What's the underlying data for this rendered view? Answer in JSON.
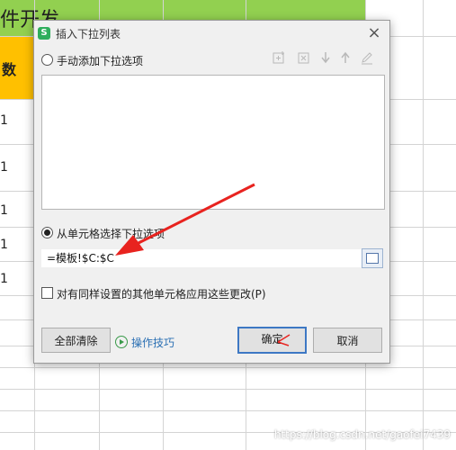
{
  "sheet": {
    "title_partial": "件开发",
    "column_header_partial": "数",
    "row_values": [
      "1",
      "1",
      "1",
      "1",
      "1"
    ],
    "watermark": "https://blog.csdn.net/gaofei7439"
  },
  "dialog": {
    "title": "插入下拉列表",
    "close_glyph": "×",
    "manual_option_label": "手动添加下拉选项",
    "cell_option_label": "从单元格选择下拉选项",
    "source_value": "=模板!$C:$C",
    "apply_all_label": "对有同样设置的其他单元格应用这些更改(P)",
    "clear_all_button": "全部清除",
    "tips_link": "操作技巧",
    "ok_button": "确定",
    "cancel_button": "取消",
    "toolbar_icons": [
      "add-item-icon",
      "delete-item-icon",
      "move-down-icon",
      "move-up-icon",
      "edit-item-icon"
    ],
    "manual_selected": false,
    "cell_selected": true,
    "apply_all_checked": false
  },
  "colors": {
    "title_band": "#92d050",
    "header_cell": "#ffc000",
    "annotation_arrow": "#e8231f",
    "link": "#2a6fb3"
  }
}
